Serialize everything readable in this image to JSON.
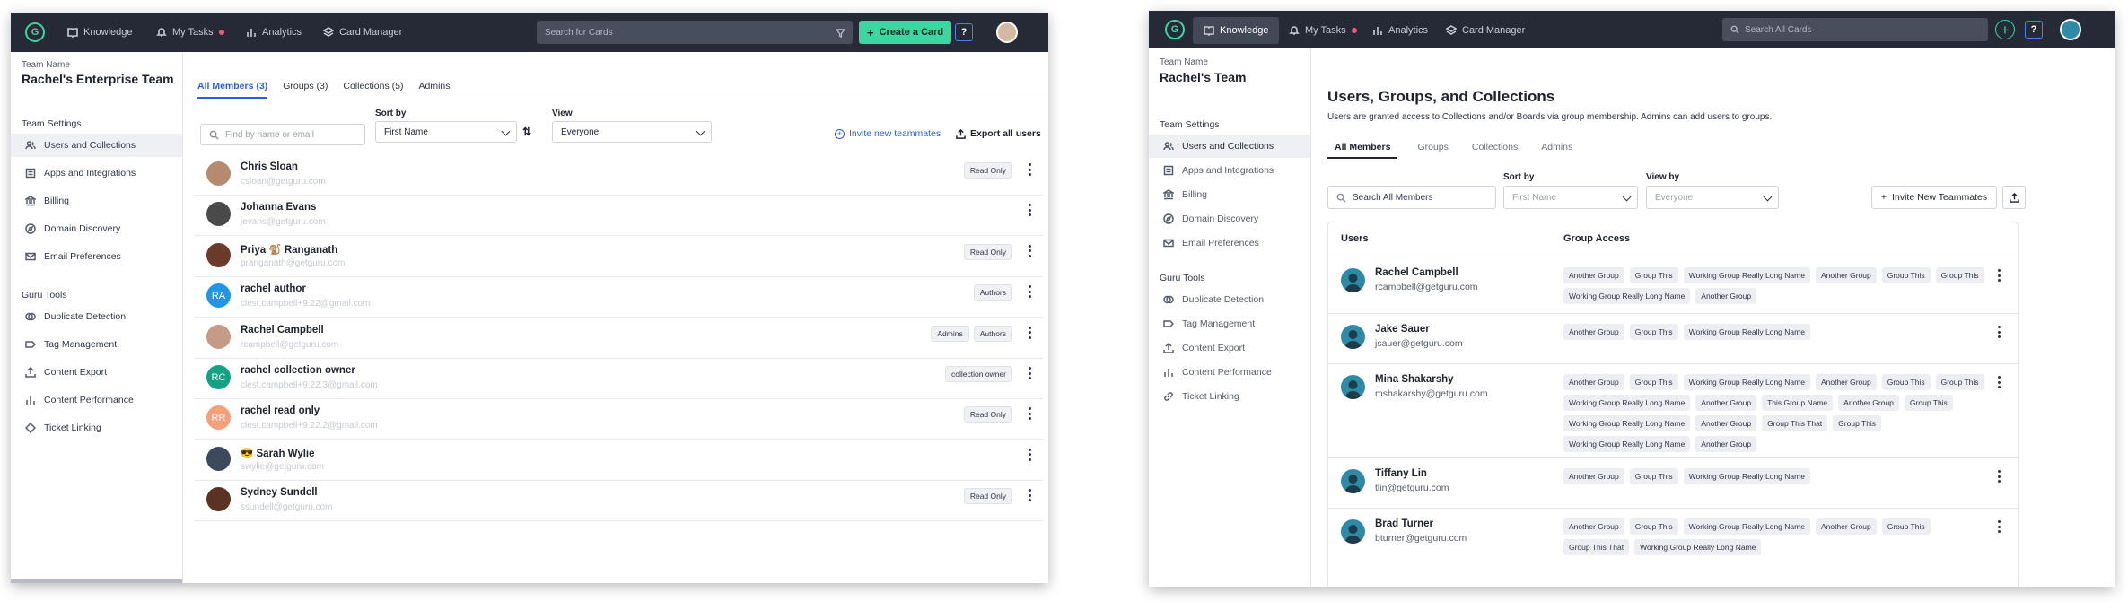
{
  "w1": {
    "nav": {
      "logo": "G",
      "items": [
        "Knowledge",
        "My Tasks",
        "Analytics",
        "Card Manager"
      ],
      "search_placeholder": "Search for Cards",
      "create": "Create a Card",
      "help": "?"
    },
    "side": {
      "team_label": "Team Name",
      "team_name": "Rachel's Enterprise Team",
      "settings_title": "Team Settings",
      "settings": [
        "Users and Collections",
        "Apps and Integrations",
        "Billing",
        "Domain Discovery",
        "Email Preferences"
      ],
      "tools_title": "Guru Tools",
      "tools": [
        "Duplicate Detection",
        "Tag Management",
        "Content Export",
        "Content Performance",
        "Ticket Linking"
      ]
    },
    "tabs": [
      "All Members (3)",
      "Groups (3)",
      "Collections (5)",
      "Admins"
    ],
    "filter": {
      "find_placeholder": "Find by name or email",
      "sort_label": "Sort by",
      "sort_value": "First Name",
      "view_label": "View",
      "view_value": "Everyone",
      "invite": "Invite new teammates",
      "export": "Export all users"
    },
    "members": [
      {
        "name": "Chris Sloan",
        "email": "csloan@getguru.com",
        "badges": [
          "Read Only"
        ],
        "initials": "",
        "color": "#b58a6f"
      },
      {
        "name": "Johanna Evans",
        "email": "jevans@getguru.com",
        "badges": [],
        "initials": "",
        "color": "#4a4a4a"
      },
      {
        "name": "Priya 🐒 Ranganath",
        "email": "pranganath@getguru.com",
        "badges": [
          "Read Only"
        ],
        "initials": "",
        "color": "#6b3a2a"
      },
      {
        "name": "rachel author",
        "email": "clest.campbell+9.22@gmail.com",
        "badges": [
          "Authors"
        ],
        "initials": "RA",
        "color": "#2196e8"
      },
      {
        "name": "Rachel Campbell",
        "email": "rcampbell@getguru.com",
        "badges": [
          "Admins",
          "Authors"
        ],
        "initials": "",
        "color": "#c79a86"
      },
      {
        "name": "rachel collection owner",
        "email": "clest.campbell+9.22.3@gmail.com",
        "badges": [
          "collection owner"
        ],
        "initials": "RC",
        "color": "#16a086"
      },
      {
        "name": "rachel read only",
        "email": "clest.campbell+9.22.2@gmail.com",
        "badges": [
          "Read Only"
        ],
        "initials": "RR",
        "color": "#f4a07a"
      },
      {
        "name": "😎 Sarah Wylie",
        "email": "swylie@getguru.com",
        "badges": [],
        "initials": "",
        "color": "#3d4a5e"
      },
      {
        "name": "Sydney Sundell",
        "email": "ssundell@getguru.com",
        "badges": [
          "Read Only"
        ],
        "initials": "",
        "color": "#5a3322"
      }
    ]
  },
  "w2": {
    "nav": {
      "logo": "G",
      "items": [
        "Knowledge",
        "My Tasks",
        "Analytics",
        "Card Manager"
      ],
      "search_placeholder": "Search All Cards",
      "plus": "+",
      "help": "?"
    },
    "side": {
      "team_label": "Team Name",
      "team_name": "Rachel's Team",
      "settings_title": "Team Settings",
      "settings": [
        "Users and Collections",
        "Apps and Integrations",
        "Billing",
        "Domain Discovery",
        "Email Preferences"
      ],
      "tools_title": "Guru Tools",
      "tools": [
        "Duplicate Detection",
        "Tag Management",
        "Content Export",
        "Content Performance",
        "Ticket Linking"
      ]
    },
    "title": "Users, Groups, and Collections",
    "subtitle": "Users are granted access to Collections and/or Boards via group membership. Admins can add users to groups.",
    "tabs": [
      "All Members",
      "Groups",
      "Collections",
      "Admins"
    ],
    "filter": {
      "search_placeholder": "Search All Members",
      "sort_label": "Sort by",
      "sort_value": "First Name",
      "view_label": "View by",
      "view_value": "Everyone",
      "invite": "Invite New Teammates"
    },
    "table": {
      "col_users": "Users",
      "col_access": "Group Access",
      "rows": [
        {
          "name": "Rachel Campbell",
          "email": "rcampbell@getguru.com",
          "groups": [
            "Another Group",
            "Group This",
            "Working Group Really Long Name",
            "Another Group",
            "Group This",
            "Group This",
            "Working Group Really Long Name",
            "Another Group"
          ]
        },
        {
          "name": "Jake Sauer",
          "email": "jsauer@getguru.com",
          "groups": [
            "Another Group",
            "Group This",
            "Working Group Really Long Name"
          ]
        },
        {
          "name": "Mina Shakarshy",
          "email": "mshakarshy@getguru.com",
          "groups": [
            "Another Group",
            "Group This",
            "Working Group Really Long Name",
            "Another Group",
            "Group This",
            "Group This",
            "Working Group Really Long Name",
            "Another Group",
            "This Group Name",
            "Another Group",
            "Group This",
            "Working Group Really Long Name",
            "Another Group",
            "Group This That",
            "Group This",
            "Working Group Really Long Name",
            "Another Group"
          ]
        },
        {
          "name": "Tiffany Lin",
          "email": "tlin@getguru.com",
          "groups": [
            "Another Group",
            "Group This",
            "Working Group Really Long Name"
          ]
        },
        {
          "name": "Brad Turner",
          "email": "bturner@getguru.com",
          "groups": [
            "Another Group",
            "Group This",
            "Working Group Really Long Name",
            "Another Group",
            "Group This",
            "Group This That",
            "Working Group Really Long Name"
          ]
        }
      ]
    }
  }
}
